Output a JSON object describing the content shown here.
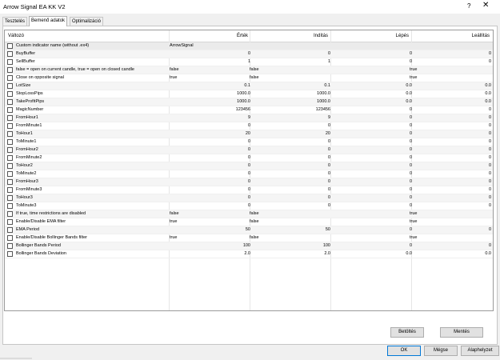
{
  "window": {
    "title": "Arrow Signal EA KK V2",
    "help_label": "?",
    "close_label": "✕"
  },
  "tabs": [
    {
      "label": "Tesztelés"
    },
    {
      "label": "Bemenő adatok"
    },
    {
      "label": "Optimalizáció"
    }
  ],
  "grid": {
    "headers": {
      "name": "Változó",
      "value": "Érték",
      "start": "Indítás",
      "step": "Lépés",
      "stop": "Leállítás"
    },
    "rows": [
      {
        "name": "Custom indicator name (without .ex4)",
        "value": "ArrowSignal",
        "start": "",
        "step": "",
        "stop": ""
      },
      {
        "name": "BuyBuffer",
        "value": "0",
        "start": "0",
        "step": "0",
        "stop": "0"
      },
      {
        "name": "SellBuffer",
        "value": "1",
        "start": "1",
        "step": "0",
        "stop": "0"
      },
      {
        "name": "false = open on current candle, true = open on closed candle",
        "value": "false",
        "start": "false",
        "step": "true",
        "stop": ""
      },
      {
        "name": "Close on opposite signal",
        "value": "true",
        "start": "false",
        "step": "true",
        "stop": ""
      },
      {
        "name": "LotSize",
        "value": "0.1",
        "start": "0.1",
        "step": "0.0",
        "stop": "0.0"
      },
      {
        "name": "StopLossPips",
        "value": "1000.0",
        "start": "1000.0",
        "step": "0.0",
        "stop": "0.0"
      },
      {
        "name": "TakeProfitPips",
        "value": "1000.0",
        "start": "1000.0",
        "step": "0.0",
        "stop": "0.0"
      },
      {
        "name": "MagicNumber",
        "value": "123456",
        "start": "123456",
        "step": "0",
        "stop": "0"
      },
      {
        "name": "FromHour1",
        "value": "9",
        "start": "9",
        "step": "0",
        "stop": "0"
      },
      {
        "name": "FromMinute1",
        "value": "0",
        "start": "0",
        "step": "0",
        "stop": "0"
      },
      {
        "name": "ToHour1",
        "value": "20",
        "start": "20",
        "step": "0",
        "stop": "0"
      },
      {
        "name": "ToMinute1",
        "value": "0",
        "start": "0",
        "step": "0",
        "stop": "0"
      },
      {
        "name": "FromHour2",
        "value": "0",
        "start": "0",
        "step": "0",
        "stop": "0"
      },
      {
        "name": "FromMinute2",
        "value": "0",
        "start": "0",
        "step": "0",
        "stop": "0"
      },
      {
        "name": "ToHour2",
        "value": "0",
        "start": "0",
        "step": "0",
        "stop": "0"
      },
      {
        "name": "ToMinute2",
        "value": "0",
        "start": "0",
        "step": "0",
        "stop": "0"
      },
      {
        "name": "FromHour3",
        "value": "0",
        "start": "0",
        "step": "0",
        "stop": "0"
      },
      {
        "name": "FromMinute3",
        "value": "0",
        "start": "0",
        "step": "0",
        "stop": "0"
      },
      {
        "name": "ToHour3",
        "value": "0",
        "start": "0",
        "step": "0",
        "stop": "0"
      },
      {
        "name": "ToMinute3",
        "value": "0",
        "start": "0",
        "step": "0",
        "stop": "0"
      },
      {
        "name": "If true, time restrictions are disabled",
        "value": "false",
        "start": "false",
        "step": "true",
        "stop": ""
      },
      {
        "name": "Enable/Disable EMA filter",
        "value": "true",
        "start": "false",
        "step": "true",
        "stop": ""
      },
      {
        "name": "EMA Period",
        "value": "50",
        "start": "50",
        "step": "0",
        "stop": "0"
      },
      {
        "name": "Enable/Disable Bollinger Bands filter",
        "value": "true",
        "start": "false",
        "step": "true",
        "stop": ""
      },
      {
        "name": "Bollinger Bands Period",
        "value": "100",
        "start": "100",
        "step": "0",
        "stop": "0"
      },
      {
        "name": "Bollinger Bands Deviation",
        "value": "2.0",
        "start": "2.0",
        "step": "0.0",
        "stop": "0.0"
      }
    ]
  },
  "buttons": {
    "load": "Betöltés",
    "save": "Mentés",
    "ok": "OK",
    "cancel": "Mégse",
    "reset": "Alaphelyzet"
  }
}
